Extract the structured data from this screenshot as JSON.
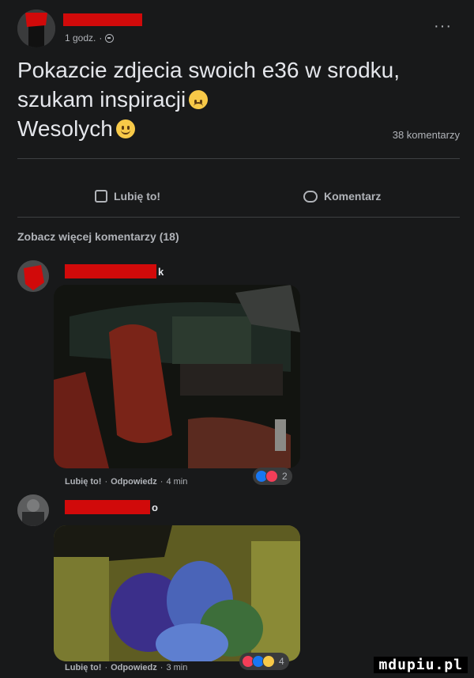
{
  "post": {
    "time": "1 godz.",
    "text_line1": "Pokazcie zdjecia swoich e36 w srodku,",
    "text_line2": "szukam inspiracji",
    "text_line3": "Wesolych",
    "comment_count": "38 komentarzy"
  },
  "actions": {
    "like": "Lubię to!",
    "comment": "Komentarz"
  },
  "see_more": "Zobacz więcej komentarzy (18)",
  "comments": [
    {
      "name_tail": "k",
      "like": "Lubię to!",
      "reply": "Odpowiedz",
      "time": "4 min",
      "reaction_count": "2"
    },
    {
      "name_tail": "o",
      "like": "Lubię to!",
      "reply": "Odpowiedz",
      "time": "3 min",
      "reaction_count": "4"
    }
  ],
  "watermark": "mdupiu.pl",
  "colors": {
    "background": "#18191a",
    "text": "#e4e6eb",
    "muted": "#b0b3b8",
    "redaction": "#d10a0a"
  }
}
